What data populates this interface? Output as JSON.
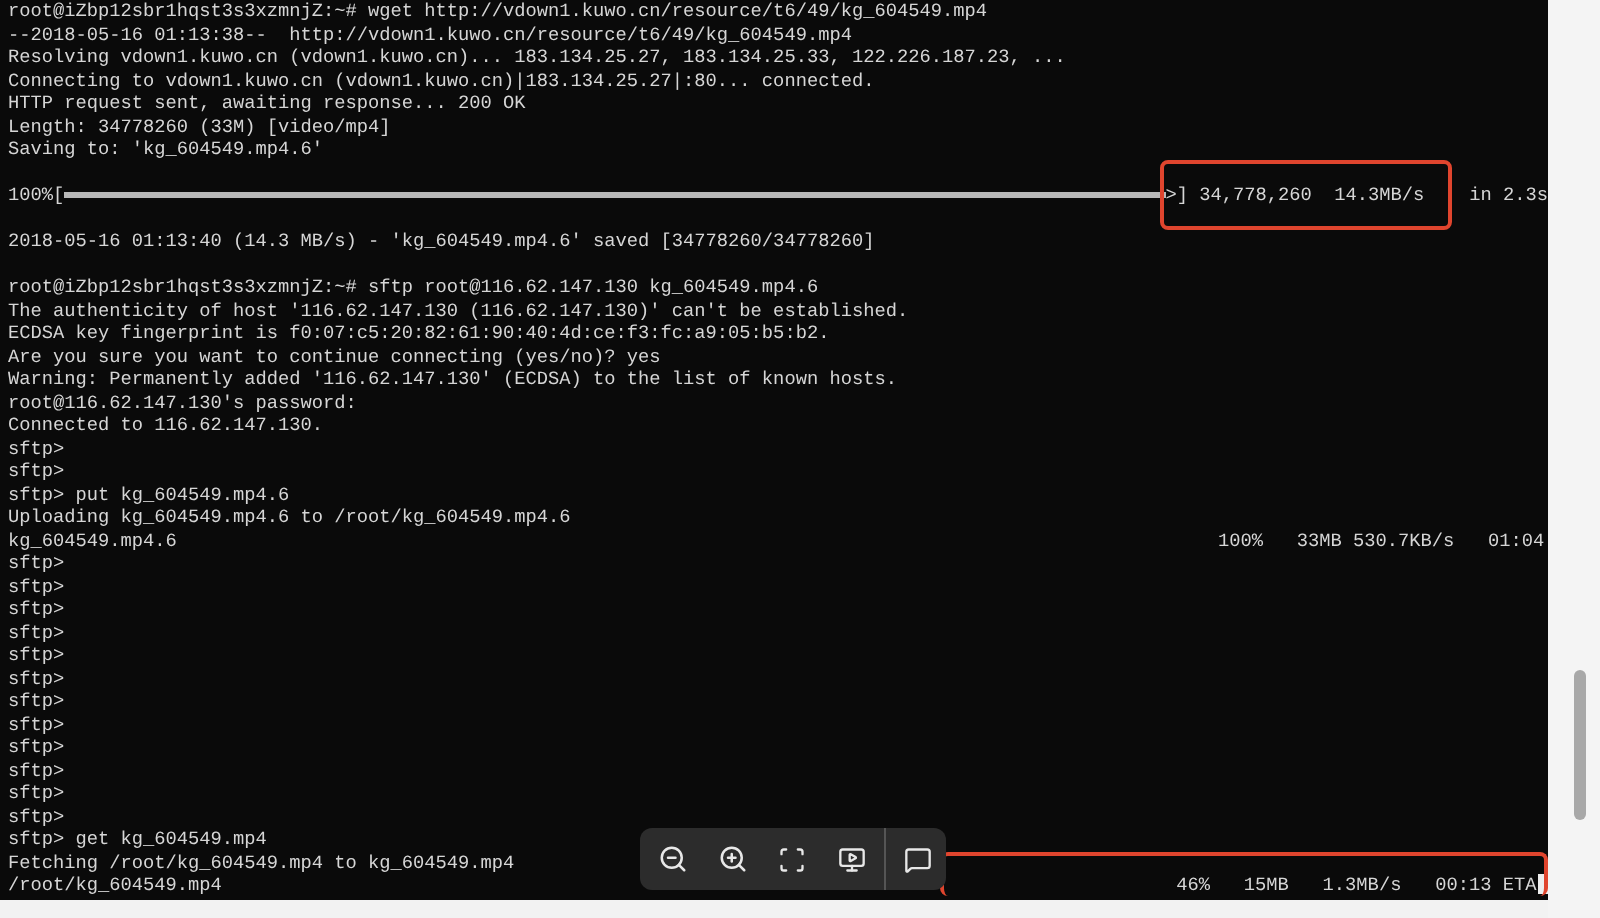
{
  "terminal": {
    "lines": [
      {
        "kind": "text",
        "text": "root@iZbp12sbr1hqst3s3xzmnjZ:~# wget http://vdown1.kuwo.cn/resource/t6/49/kg_604549.mp4"
      },
      {
        "kind": "text",
        "text": "--2018-05-16 01:13:38--  http://vdown1.kuwo.cn/resource/t6/49/kg_604549.mp4"
      },
      {
        "kind": "text",
        "text": "Resolving vdown1.kuwo.cn (vdown1.kuwo.cn)... 183.134.25.27, 183.134.25.33, 122.226.187.23, ..."
      },
      {
        "kind": "text",
        "text": "Connecting to vdown1.kuwo.cn (vdown1.kuwo.cn)|183.134.25.27|:80... connected."
      },
      {
        "kind": "text",
        "text": "HTTP request sent, awaiting response... 200 OK"
      },
      {
        "kind": "text",
        "text": "Length: 34778260 (33M) [video/mp4]"
      },
      {
        "kind": "text",
        "text": "Saving to: 'kg_604549.mp4.6'"
      },
      {
        "kind": "blank"
      },
      {
        "kind": "progress",
        "prefix": "100%[",
        "level": 1,
        "suffix": ">] 34,778,260  14.3MB/s    in 2.3s",
        "highlighted": true
      },
      {
        "kind": "blank"
      },
      {
        "kind": "text",
        "text": "2018-05-16 01:13:40 (14.3 MB/s) - 'kg_604549.mp4.6' saved [34778260/34778260]"
      },
      {
        "kind": "blank"
      },
      {
        "kind": "text",
        "text": "root@iZbp12sbr1hqst3s3xzmnjZ:~# sftp root@116.62.147.130 kg_604549.mp4.6"
      },
      {
        "kind": "text",
        "text": "The authenticity of host '116.62.147.130 (116.62.147.130)' can't be established."
      },
      {
        "kind": "text",
        "text": "ECDSA key fingerprint is f0:07:c5:20:82:61:90:40:4d:ce:f3:fc:a9:05:b5:b2."
      },
      {
        "kind": "text",
        "text": "Are you sure you want to continue connecting (yes/no)? yes"
      },
      {
        "kind": "text",
        "text": "Warning: Permanently added '116.62.147.130' (ECDSA) to the list of known hosts."
      },
      {
        "kind": "text",
        "text": "root@116.62.147.130's password:"
      },
      {
        "kind": "text",
        "text": "Connected to 116.62.147.130."
      },
      {
        "kind": "text",
        "text": "sftp>"
      },
      {
        "kind": "text",
        "text": "sftp>"
      },
      {
        "kind": "text",
        "text": "sftp> put kg_604549.mp4.6"
      },
      {
        "kind": "text",
        "text": "Uploading kg_604549.mp4.6 to /root/kg_604549.mp4.6"
      },
      {
        "kind": "transfer",
        "text": "kg_604549.mp4.6",
        "stats": "100%   33MB 530.7KB/s   01:04",
        "highlighted": false,
        "cursor": false
      },
      {
        "kind": "text",
        "text": "sftp>"
      },
      {
        "kind": "text",
        "text": "sftp>"
      },
      {
        "kind": "text",
        "text": "sftp>"
      },
      {
        "kind": "text",
        "text": "sftp>"
      },
      {
        "kind": "text",
        "text": "sftp>"
      },
      {
        "kind": "text",
        "text": "sftp>"
      },
      {
        "kind": "text",
        "text": "sftp>"
      },
      {
        "kind": "text",
        "text": "sftp>"
      },
      {
        "kind": "text",
        "text": "sftp>"
      },
      {
        "kind": "text",
        "text": "sftp>"
      },
      {
        "kind": "text",
        "text": "sftp>"
      },
      {
        "kind": "text",
        "text": "sftp>"
      },
      {
        "kind": "text",
        "text": "sftp> get kg_604549.mp4"
      },
      {
        "kind": "text",
        "text": "Fetching /root/kg_604549.mp4 to kg_604549.mp4"
      },
      {
        "kind": "transfer",
        "text": "/root/kg_604549.mp4",
        "stats": "46%   15MB   1.3MB/s   00:13 ETA",
        "highlighted": true,
        "cursor": true
      }
    ]
  }
}
